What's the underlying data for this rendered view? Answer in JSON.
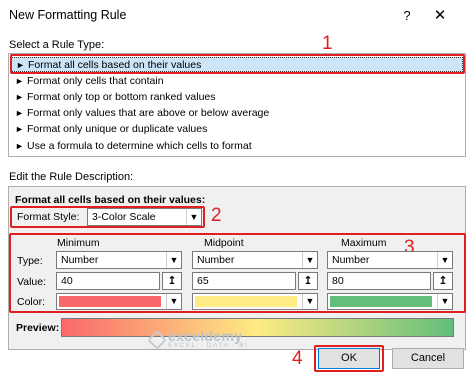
{
  "dialog": {
    "title": "New Formatting Rule",
    "help_glyph": "?",
    "close_glyph": "✕"
  },
  "rule_type": {
    "label": "Select a Rule Type:",
    "items": [
      "Format all cells based on their values",
      "Format only cells that contain",
      "Format only top or bottom ranked values",
      "Format only values that are above or below average",
      "Format only unique or duplicate values",
      "Use a formula to determine which cells to format"
    ],
    "selected_index": 0
  },
  "description": {
    "label": "Edit the Rule Description:",
    "heading": "Format all cells based on their values:",
    "format_style_label": "Format Style:",
    "format_style_value": "3-Color Scale",
    "columns": [
      "Minimum",
      "Midpoint",
      "Maximum"
    ],
    "row_labels": {
      "type": "Type:",
      "value": "Value:",
      "color": "Color:"
    },
    "types": [
      "Number",
      "Number",
      "Number"
    ],
    "values": [
      "40",
      "65",
      "80"
    ],
    "colors": [
      "#f8696b",
      "#ffeb84",
      "#63be7b"
    ],
    "preview_label": "Preview:"
  },
  "buttons": {
    "ok": "OK",
    "cancel": "Cancel"
  },
  "annotations": [
    "1",
    "2",
    "3",
    "4"
  ],
  "watermark": {
    "name": "exceldemy",
    "tagline": "EXCEL · DATA · BI"
  },
  "icons": {
    "dropdown": "chevron-down-icon",
    "range_picker": "range-select-icon",
    "list_arrow": "arrow-right-icon"
  }
}
